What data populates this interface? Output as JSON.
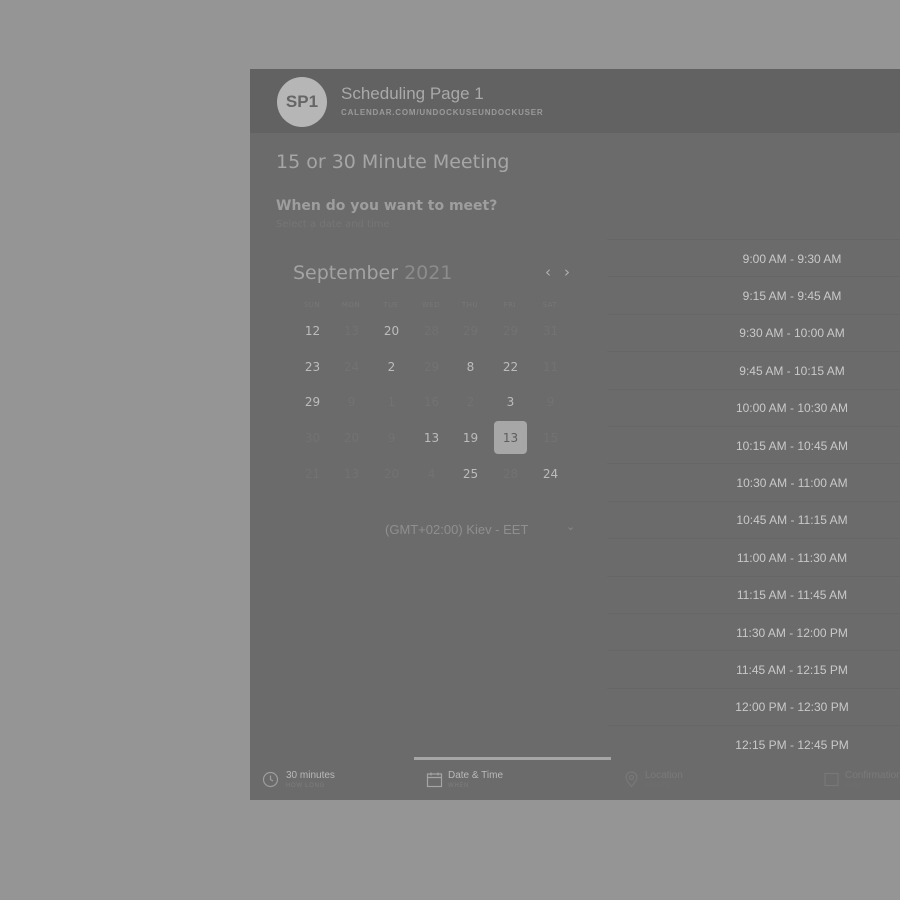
{
  "header": {
    "avatar_initials": "SP1",
    "page_title": "Scheduling Page 1",
    "page_url": "CALENDAR.COM/UNDOCKUSEUNDOCKUSER"
  },
  "meeting": {
    "title": "15 or 30 Minute Meeting",
    "question": "When do you want to meet?",
    "hint": "Select a date and time"
  },
  "calendar": {
    "month": "September",
    "year": "2021",
    "prev_icon": "chevron-left-icon",
    "next_icon": "chevron-right-icon",
    "weekdays": [
      "SUN",
      "MON",
      "TUE",
      "WED",
      "THU",
      "FRI",
      "SAT"
    ],
    "weeks": [
      [
        {
          "d": "12",
          "s": "on"
        },
        {
          "d": "13",
          "s": "off"
        },
        {
          "d": "20",
          "s": "on"
        },
        {
          "d": "28",
          "s": "off"
        },
        {
          "d": "29",
          "s": "off"
        },
        {
          "d": "29",
          "s": "off"
        },
        {
          "d": "31",
          "s": "off"
        }
      ],
      [
        {
          "d": "23",
          "s": "on"
        },
        {
          "d": "24",
          "s": "off"
        },
        {
          "d": "2",
          "s": "on"
        },
        {
          "d": "29",
          "s": "off"
        },
        {
          "d": "8",
          "s": "on"
        },
        {
          "d": "22",
          "s": "on"
        },
        {
          "d": "11",
          "s": "off"
        }
      ],
      [
        {
          "d": "29",
          "s": "on"
        },
        {
          "d": "9",
          "s": "off"
        },
        {
          "d": "1",
          "s": "off"
        },
        {
          "d": "16",
          "s": "off"
        },
        {
          "d": "2",
          "s": "off"
        },
        {
          "d": "3",
          "s": "on"
        },
        {
          "d": "9",
          "s": "off"
        }
      ],
      [
        {
          "d": "30",
          "s": "off"
        },
        {
          "d": "20",
          "s": "off"
        },
        {
          "d": "9",
          "s": "off"
        },
        {
          "d": "13",
          "s": "on"
        },
        {
          "d": "19",
          "s": "on"
        },
        {
          "d": "13",
          "s": "sel"
        },
        {
          "d": "15",
          "s": "off"
        }
      ],
      [
        {
          "d": "21",
          "s": "off"
        },
        {
          "d": "13",
          "s": "off"
        },
        {
          "d": "20",
          "s": "off"
        },
        {
          "d": "4",
          "s": "off"
        },
        {
          "d": "25",
          "s": "on"
        },
        {
          "d": "28",
          "s": "off"
        },
        {
          "d": "24",
          "s": "on"
        }
      ]
    ]
  },
  "timezone": {
    "value": "(GMT+02:00) Kiev - EET",
    "caret_icon": "chevron-down-icon"
  },
  "time_slots": [
    "9:00 AM - 9:30 AM",
    "9:15 AM - 9:45 AM",
    "9:30 AM - 10:00 AM",
    "9:45 AM - 10:15 AM",
    "10:00 AM - 10:30 AM",
    "10:15 AM - 10:45 AM",
    "10:30 AM - 11:00 AM",
    "10:45 AM - 11:15 AM",
    "11:00 AM - 11:30 AM",
    "11:15 AM - 11:45 AM",
    "11:30 AM - 12:00 PM",
    "11:45 AM - 12:15 PM",
    "12:00 PM - 12:30 PM",
    "12:15 PM - 12:45 PM"
  ],
  "footer": {
    "steps": [
      {
        "label": "30 minutes",
        "sub": "HOW LONG",
        "icon": "clock-icon"
      },
      {
        "label": "Date & Time",
        "sub": "WHEN",
        "icon": "calendar-icon"
      },
      {
        "label": "Location",
        "sub": "WHERE",
        "icon": "location-pin-icon"
      },
      {
        "label": "Confirmation",
        "sub": "WHO",
        "icon": "checkbox-icon"
      }
    ],
    "active_step": 1
  }
}
